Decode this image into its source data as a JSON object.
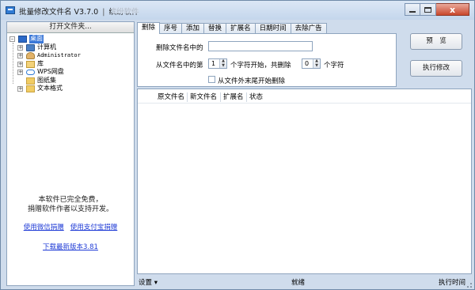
{
  "window": {
    "title": "批量修改文件名 V3.7.0",
    "title_separator": "|",
    "title_suffix": "缤纷软件",
    "controls": {
      "minimize": "–",
      "maximize": "□",
      "close": "x"
    }
  },
  "left_panel": {
    "open_folder_button": "打开文件夹...",
    "tree": [
      {
        "label": "桌面",
        "icon": "desktop-icon",
        "selected": true
      },
      {
        "label": "计算机",
        "icon": "computer-icon",
        "expander": "+"
      },
      {
        "label": "Administrator",
        "icon": "user-folder-icon",
        "expander": "+"
      },
      {
        "label": "库",
        "icon": "library-icon",
        "expander": "+"
      },
      {
        "label": "WPS网盘",
        "icon": "cloud-icon",
        "expander": "+"
      },
      {
        "label": "图纸集",
        "icon": "folder-icon"
      },
      {
        "label": "文本格式",
        "icon": "folder-icon",
        "expander": "+"
      }
    ],
    "free_text_line1": "本软件已完全免费，",
    "free_text_line2": "捐赠软件作者以支持开发。",
    "donate_wechat": "使用微信捐赠",
    "donate_alipay": "使用支付宝捐赠",
    "download_latest": "下载最新版本3.81"
  },
  "tabs": [
    "删除",
    "序号",
    "添加",
    "替换",
    "扩展名",
    "日期时间",
    "去除广告"
  ],
  "delete_tab": {
    "delete_in_name_label": "删除文件名中的",
    "delete_in_name_value": "",
    "from_position_label": "从文件名中的第",
    "start_value": "1",
    "start_suffix": "个字符开始，共删除",
    "count_value": "0",
    "count_suffix": "个字符",
    "from_end_checkbox_label": "从文件外末尾开始删除",
    "spin_up": "▲",
    "spin_down": "▼"
  },
  "buttons": {
    "preview": "预　览",
    "execute": "执行修改"
  },
  "table": {
    "columns": [
      "原文件名",
      "新文件名",
      "扩展名",
      "状态"
    ],
    "rows": []
  },
  "statusbar": {
    "settings": "设置 ▾",
    "status": "就绪",
    "exec_time": "执行时间"
  }
}
